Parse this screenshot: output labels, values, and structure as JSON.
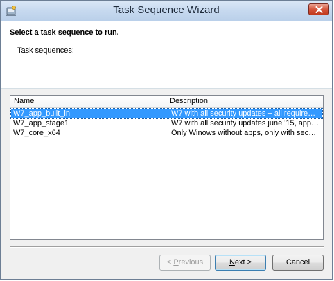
{
  "window": {
    "title": "Task Sequence Wizard"
  },
  "header": {
    "heading": "Select a task sequence to run.",
    "sublabel": "Task sequences:"
  },
  "list": {
    "columns": {
      "name": "Name",
      "description": "Description"
    },
    "rows": [
      {
        "name": "W7_app_built_in",
        "description": "W7 with all security updates + all require…",
        "selected": true
      },
      {
        "name": "W7_app_stage1",
        "description": "W7 with all security updates june '15, app…",
        "selected": false
      },
      {
        "name": "W7_core_x64",
        "description": "Only Winows without apps, only with sec…",
        "selected": false
      }
    ]
  },
  "buttons": {
    "previous": {
      "prefix": "< ",
      "accel": "P",
      "rest": "revious",
      "enabled": false
    },
    "next": {
      "accel": "N",
      "rest": "ext >",
      "enabled": true
    },
    "cancel": {
      "label": "Cancel",
      "enabled": true
    }
  },
  "colors": {
    "selection": "#3399ff",
    "title_bar": "#c6d9ef",
    "close_button": "#d5553c"
  }
}
